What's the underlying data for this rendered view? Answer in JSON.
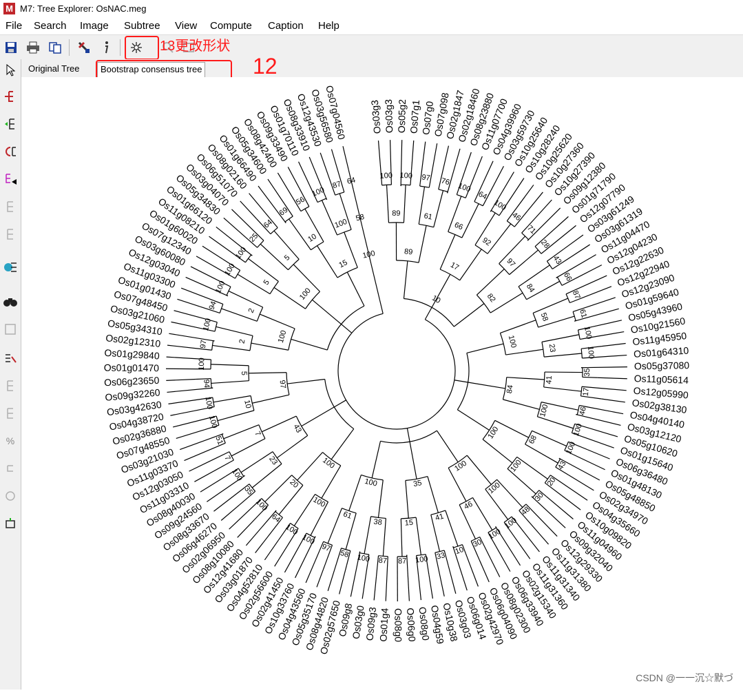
{
  "app": {
    "icon_letter": "M",
    "title": "M7: Tree Explorer: OsNAC.meg"
  },
  "menu": [
    "File",
    "Search",
    "Image",
    "Subtree",
    "View",
    "Compute",
    "Caption",
    "Help"
  ],
  "toolbar": {
    "icons": [
      "save-icon",
      "print-icon",
      "copy-icon",
      "tools-icon",
      "info-icon",
      "tree-shape-icon",
      "zoom-icon",
      "format-icon"
    ]
  },
  "sidebar": {
    "icons": [
      "pointer-icon",
      "swap-branches-icon",
      "flip-subtree-icon",
      "root-icon",
      "compress-icon",
      "disabled-icon",
      "disabled-icon",
      "subtree-icon",
      "search-icon",
      "disabled-icon",
      "disabled-icon",
      "disabled-icon",
      "percent-icon",
      "disabled-icon",
      "disabled-icon",
      "toggle-icon"
    ]
  },
  "tabs": [
    {
      "label": "Original Tree",
      "active": false
    },
    {
      "label": "Bootstrap consensus tree",
      "active": true
    }
  ],
  "annotations": {
    "toolbar_note": "13更改形状",
    "tab_note": "12"
  },
  "tree": {
    "leaves": [
      "Os03g3",
      "Os03g3",
      "Os05g2",
      "Os07g1",
      "Os07g0",
      "Os07g098",
      "Os02g1847",
      "Os02g18460",
      "Os08g23880",
      "Os11g07700",
      "Os04g39960",
      "Os03g59730",
      "Os10g25640",
      "Os10g28240",
      "Os10g25620",
      "Os10g27360",
      "Os10g27390",
      "Os09g12380",
      "Os01g71790",
      "Os12g07790",
      "Os03g61249",
      "Os03g61319",
      "Os11g04470",
      "Os12g04230",
      "Os12g22630",
      "Os12g22940",
      "Os12g23090",
      "Os01g59640",
      "Os05g43960",
      "Os10g21560",
      "Os11g45950",
      "Os01g64310",
      "Os05g37080",
      "Os11g05614",
      "Os12g05990",
      "Os02g38130",
      "Os04g40140",
      "Os03g12120",
      "Os05g10620",
      "Os01g15640",
      "Os06g36480",
      "Os01g48130",
      "Os05g48850",
      "Os02g34970",
      "Os04g35660",
      "Os10g09820",
      "Os11g04960",
      "Os09g32040",
      "Os12g29330",
      "Os11g31380",
      "Os11g31340",
      "Os11g31360",
      "Os02g15340",
      "Os06g33940",
      "Os08g02300",
      "Os06g04090",
      "Os02g42970",
      "Os06g014",
      "Os03g03",
      "Os10g38",
      "Os04g59",
      "Os08g0",
      "Os06g0",
      "Os08g0",
      "Os01g4",
      "Os09g3",
      "Os03g0",
      "Os09g8",
      "Os02g57650",
      "Os08g44820",
      "Os05g35170",
      "Os04g43560",
      "Os10g33760",
      "Os02g41450",
      "Os02g56600",
      "Os04g52810",
      "Os03g01870",
      "Os12g41680",
      "Os08g10080",
      "Os02g06950",
      "Os06g46270",
      "Os08g33670",
      "Os09g24560",
      "Os08g40030",
      "Os11g03310",
      "Os12g03050",
      "Os11g03370",
      "Os03g21030",
      "Os07g48550",
      "Os02g36880",
      "Os04g38720",
      "Os03g42630",
      "Os09g32260",
      "Os06g23650",
      "Os01g01470",
      "Os01g29840",
      "Os02g12310",
      "Os05g34310",
      "Os03g21060",
      "Os07g48450",
      "Os01g01430",
      "Os11g03300",
      "Os12g03040",
      "Os03g60080",
      "Os07g12340",
      "Os01g60020",
      "Os11g08210",
      "Os01g66120",
      "Os05g34830",
      "Os03g04070",
      "Os06g51070",
      "Os08g02160",
      "Os01g66490",
      "Os05g34600",
      "Os08g42400",
      "Os09g33490",
      "Os01g70110",
      "Os08g33910",
      "Os12g43530",
      "Os03g56580",
      "Os07g04560"
    ],
    "bootstrap_labels": [
      "100",
      "100",
      "97",
      "76",
      "100",
      "64",
      "100",
      "46",
      "71",
      "28",
      "43",
      "66",
      "87",
      "61",
      "100",
      "100",
      "35",
      "17",
      "46",
      "100",
      "100",
      "43",
      "20",
      "30",
      "48",
      "100",
      "100",
      "30",
      "10",
      "33",
      "100",
      "87",
      "87",
      "100",
      "58",
      "97",
      "100",
      "100",
      "64",
      "100",
      "35",
      "100",
      "7",
      "51",
      "100",
      "100",
      "94",
      "100",
      "97",
      "100",
      "94",
      "100",
      "100",
      "100",
      "25",
      "64",
      "69",
      "56",
      "100",
      "87",
      "64",
      "89",
      "61",
      "66",
      "92",
      "97",
      "84",
      "58",
      "23",
      "41",
      "100",
      "68",
      "100",
      "100",
      "46",
      "41",
      "15",
      "38",
      "61",
      "100",
      "20",
      "23",
      "7",
      "10",
      "5",
      "2",
      "2",
      "5",
      "5",
      "10",
      "100",
      "58",
      "89",
      "17",
      "82",
      "100",
      "84",
      "100",
      "100",
      "35",
      "100",
      "100",
      "43",
      "97",
      "100",
      "100",
      "15",
      "100",
      "10"
    ]
  },
  "watermark": "CSDN @一一沉☆默づ"
}
